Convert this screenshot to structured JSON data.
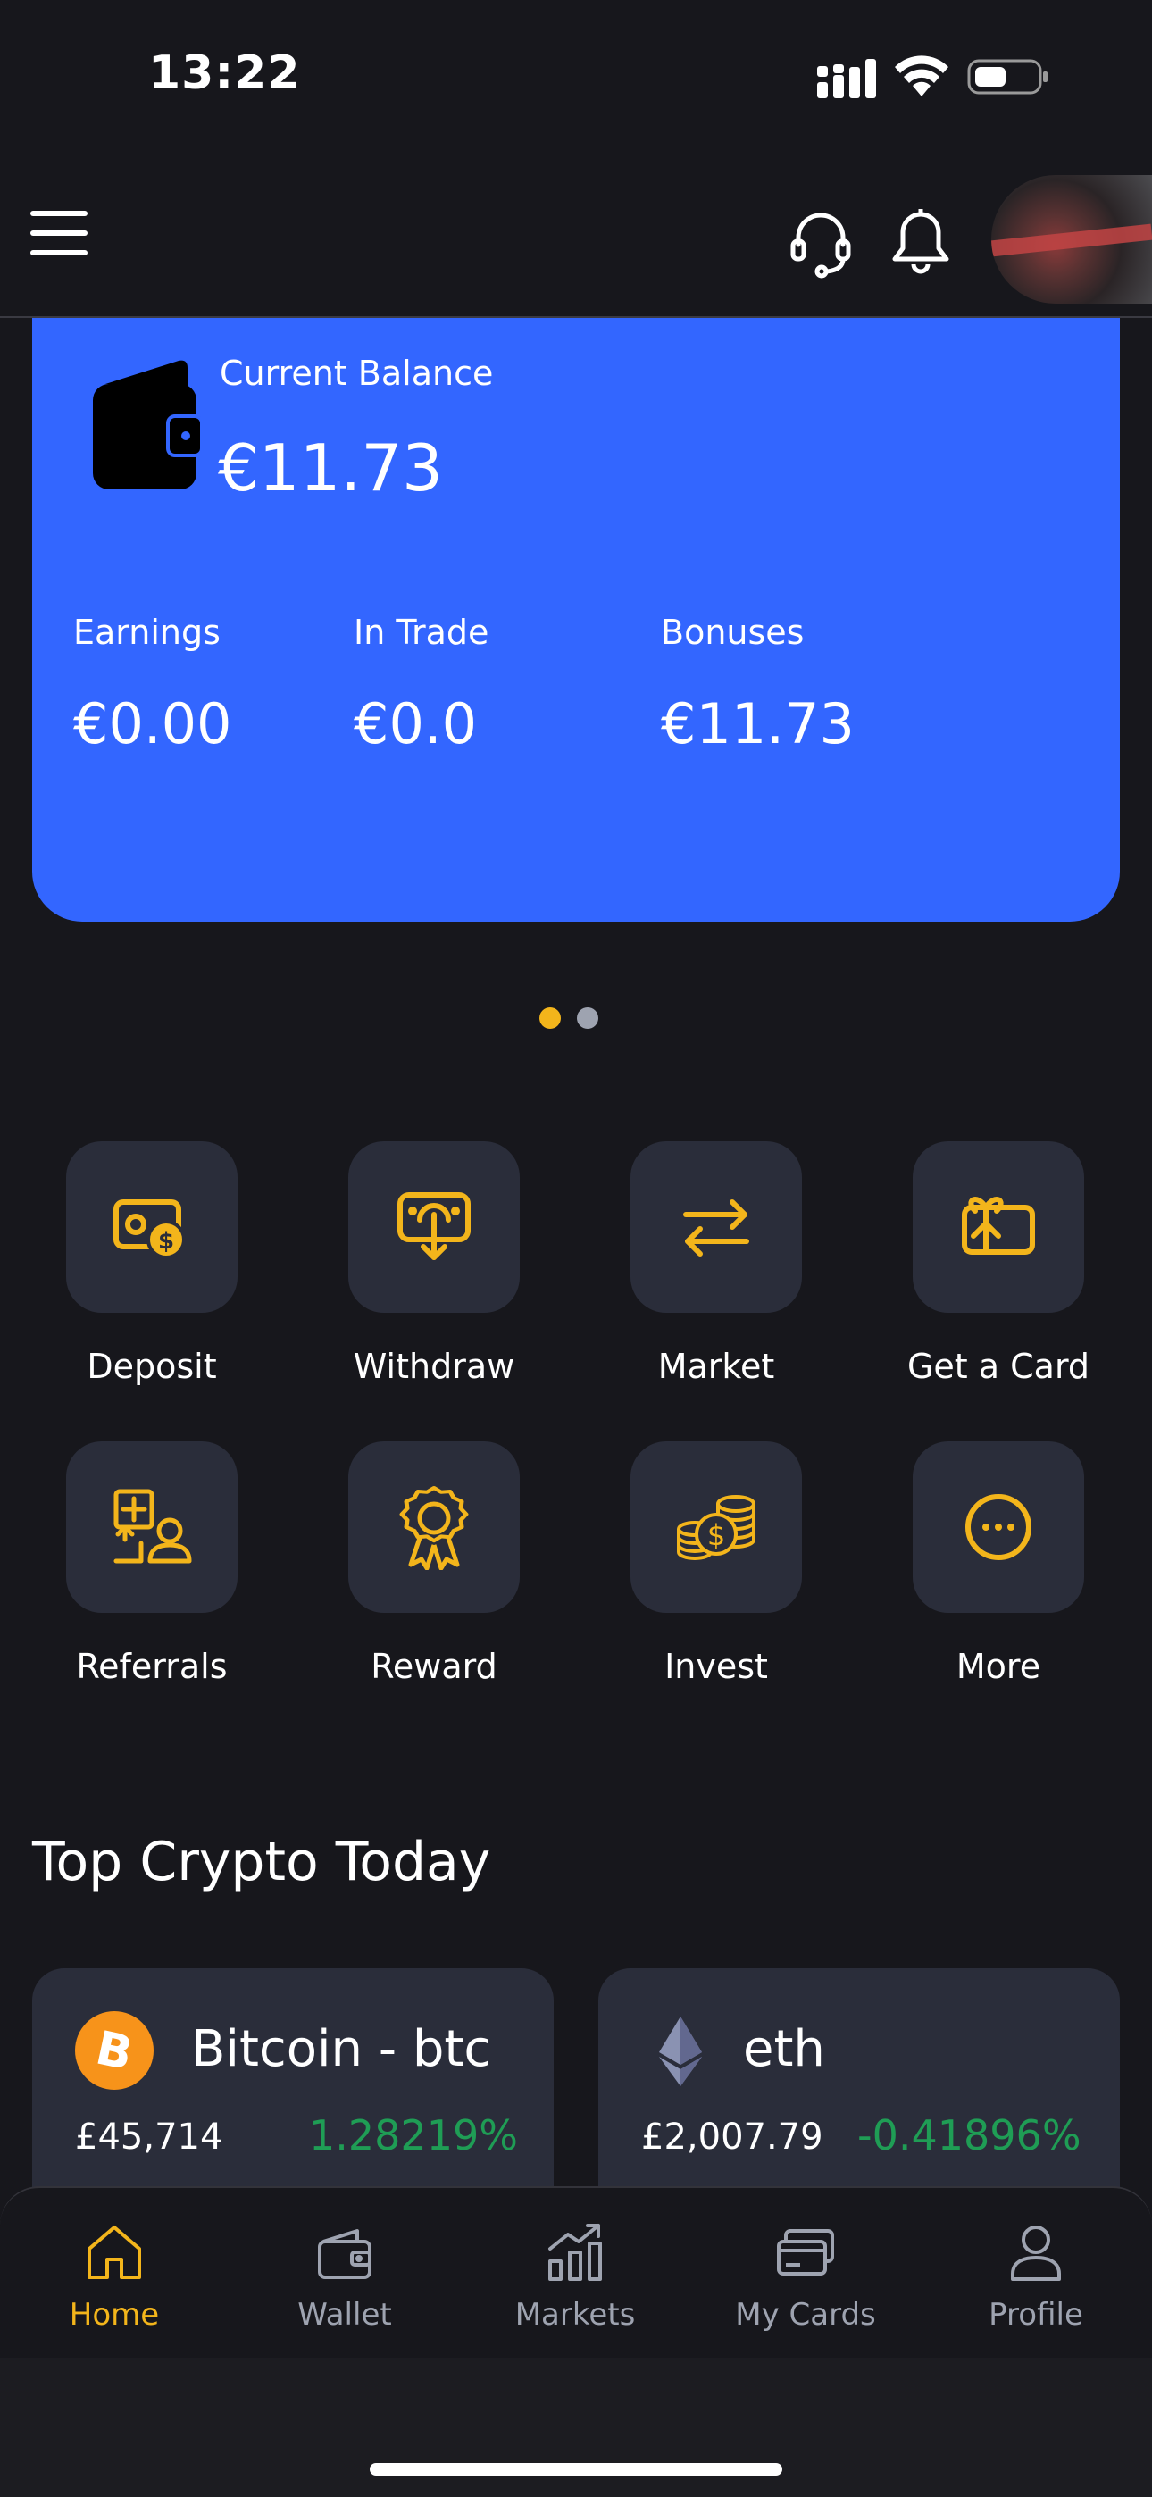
{
  "status_bar": {
    "time": "13:22"
  },
  "header": {
    "menu_icon": "hamburger-menu-icon",
    "support_icon": "headset-icon",
    "notification_icon": "bell-icon"
  },
  "balance_card": {
    "title": "Current Balance",
    "amount": "€11.73",
    "stats": [
      {
        "label": "Earnings",
        "value": "€0.00"
      },
      {
        "label": "In Trade",
        "value": "€0.0"
      },
      {
        "label": "Bonuses",
        "value": "€11.73"
      }
    ]
  },
  "carousel": {
    "pages": 2,
    "active_page": 1,
    "active_color": "#f3b51b",
    "inactive_color": "#9ea3b0"
  },
  "actions": [
    {
      "label": "Deposit",
      "icon": "deposit-icon"
    },
    {
      "label": "Withdraw",
      "icon": "withdraw-icon"
    },
    {
      "label": "Market",
      "icon": "swap-arrows-icon"
    },
    {
      "label": "Get a Card",
      "icon": "gift-card-icon"
    },
    {
      "label": "Referrals",
      "icon": "referrals-icon"
    },
    {
      "label": "Reward",
      "icon": "award-icon"
    },
    {
      "label": "Invest",
      "icon": "coins-icon"
    },
    {
      "label": "More",
      "icon": "more-icon"
    }
  ],
  "top_crypto": {
    "title": "Top Crypto Today",
    "coins": [
      {
        "name": "Bitcoin - btc",
        "price": "£45,714",
        "change": "1.28219%",
        "icon": "bitcoin-icon"
      },
      {
        "name": "eth",
        "price": "£2,007.79",
        "change": "-0.41896%",
        "icon": "ethereum-icon"
      }
    ]
  },
  "bottom_nav": {
    "items": [
      {
        "label": "Home",
        "icon": "home-icon",
        "active": true
      },
      {
        "label": "Wallet",
        "icon": "wallet-icon",
        "active": false
      },
      {
        "label": "Markets",
        "icon": "markets-icon",
        "active": false
      },
      {
        "label": "My Cards",
        "icon": "cards-icon",
        "active": false
      },
      {
        "label": "Profile",
        "icon": "profile-icon",
        "active": false
      }
    ]
  },
  "colors": {
    "background": "#17171c",
    "card_blue": "#3366ff",
    "accent": "#f3b51b",
    "tile": "#2a2d3a",
    "positive": "#1f9d55",
    "muted": "#9ea3b0"
  }
}
